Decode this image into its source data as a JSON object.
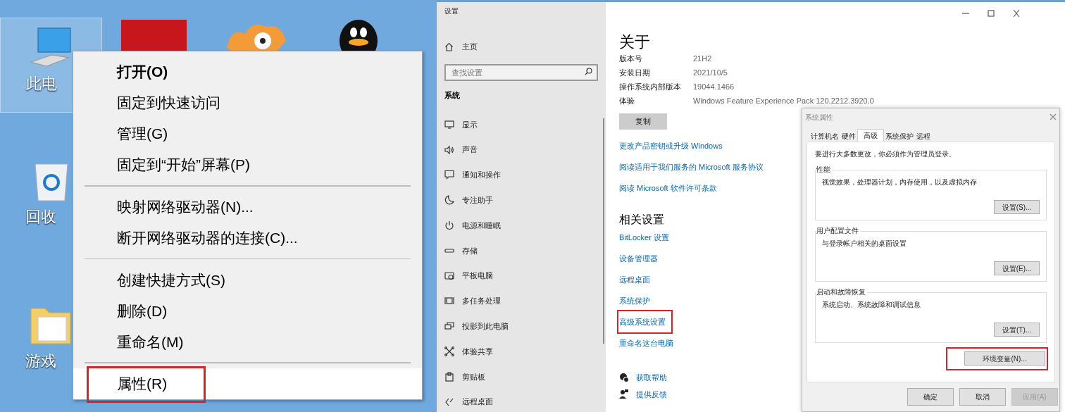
{
  "desktop": {
    "icons": [
      {
        "label": "此电",
        "kind": "computer",
        "selected": true
      },
      {
        "label": "回收",
        "kind": "recycle-bin",
        "selected": false
      },
      {
        "label": "游戏",
        "kind": "folder",
        "selected": false
      }
    ]
  },
  "context_menu": {
    "groups": [
      [
        {
          "label": "打开(O)",
          "default": true,
          "selected": false,
          "highlighted": false
        },
        {
          "label": "固定到快速访问",
          "default": false,
          "selected": false,
          "highlighted": false
        },
        {
          "label": "管理(G)",
          "default": false,
          "selected": false,
          "highlighted": false
        },
        {
          "label": "固定到“开始”屏幕(P)",
          "default": false,
          "selected": false,
          "highlighted": false
        }
      ],
      [
        {
          "label": "映射网络驱动器(N)...",
          "default": false,
          "selected": false,
          "highlighted": false
        },
        {
          "label": "断开网络驱动器的连接(C)...",
          "default": false,
          "selected": false,
          "highlighted": false
        }
      ],
      [
        {
          "label": "创建快捷方式(S)",
          "default": false,
          "selected": false,
          "highlighted": false
        },
        {
          "label": "删除(D)",
          "default": false,
          "selected": false,
          "highlighted": false
        },
        {
          "label": "重命名(M)",
          "default": false,
          "selected": false,
          "highlighted": false
        }
      ],
      [
        {
          "label": "属性(R)",
          "default": false,
          "selected": true,
          "highlighted": true
        }
      ]
    ]
  },
  "settings_window": {
    "title": "设置",
    "sidebar": {
      "home": "主页",
      "search": {
        "placeholder": "查找设置"
      },
      "section": "系统",
      "items": [
        {
          "label": "显示",
          "kind": "display"
        },
        {
          "label": "声音",
          "kind": "sound"
        },
        {
          "label": "通知和操作",
          "kind": "notifications"
        },
        {
          "label": "专注助手",
          "kind": "focus"
        },
        {
          "label": "电源和睡眠",
          "kind": "power"
        },
        {
          "label": "存储",
          "kind": "storage"
        },
        {
          "label": "平板电脑",
          "kind": "tablet"
        },
        {
          "label": "多任务处理",
          "kind": "multitasking"
        },
        {
          "label": "投影到此电脑",
          "kind": "project"
        },
        {
          "label": "体验共享",
          "kind": "shared"
        },
        {
          "label": "剪贴板",
          "kind": "clipboard"
        },
        {
          "label": "远程桌面",
          "kind": "remote"
        }
      ]
    },
    "main": {
      "heading": "关于",
      "specs": [
        {
          "label": "版本号",
          "value": "21H2"
        },
        {
          "label": "安装日期",
          "value": "2021/10/5"
        },
        {
          "label": "操作系统内部版本",
          "value": "19044.1466"
        },
        {
          "label": "体验",
          "value": "Windows Feature Experience Pack 120.2212.3920.0"
        }
      ],
      "copy_button": "复制",
      "links": [
        "更改产品密钥或升级 Windows",
        "阅读适用于我们服务的 Microsoft 服务协议",
        "阅读 Microsoft 软件许可条款"
      ],
      "related_heading": "相关设置",
      "related_links": [
        {
          "label": "BitLocker 设置",
          "highlighted": false
        },
        {
          "label": "设备管理器",
          "highlighted": false
        },
        {
          "label": "远程桌面",
          "highlighted": false
        },
        {
          "label": "系统保护",
          "highlighted": false
        },
        {
          "label": "高级系统设置",
          "highlighted": true
        },
        {
          "label": "重命名这台电脑",
          "highlighted": false
        }
      ],
      "help_links": [
        {
          "label": "获取帮助",
          "kind": "help"
        },
        {
          "label": "提供反馈",
          "kind": "feedback"
        }
      ]
    }
  },
  "system_properties": {
    "title": "系统属性",
    "tabs": [
      {
        "label": "计算机名",
        "selected": false
      },
      {
        "label": "硬件",
        "selected": false
      },
      {
        "label": "高级",
        "selected": true
      },
      {
        "label": "系统保护",
        "selected": false
      },
      {
        "label": "远程",
        "selected": false
      }
    ],
    "notice": "要进行大多数更改，你必须作为管理员登录。",
    "groups": [
      {
        "title": "性能",
        "description": "视觉效果，处理器计划，内存使用，以及虚拟内存",
        "button": "设置(S)..."
      },
      {
        "title": "用户配置文件",
        "description": "与登录帐户相关的桌面设置",
        "button": "设置(E)..."
      },
      {
        "title": "启动和故障恢复",
        "description": "系统启动、系统故障和调试信息",
        "button": "设置(T)..."
      }
    ],
    "env_button": {
      "label": "环境变量(N)...",
      "highlighted": true
    },
    "footer_buttons": [
      {
        "label": "确定",
        "disabled": false
      },
      {
        "label": "取消",
        "disabled": false
      },
      {
        "label": "应用(A)",
        "disabled": true
      }
    ]
  }
}
